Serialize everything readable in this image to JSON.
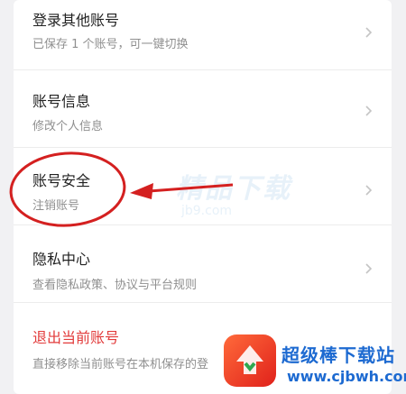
{
  "settings": {
    "items": [
      {
        "title": "登录其他账号",
        "subtitle": "已保存 1 个账号，可一键切换"
      },
      {
        "title": "账号信息",
        "subtitle": "修改个人信息"
      },
      {
        "title": "账号安全",
        "subtitle": "注销账号"
      },
      {
        "title": "隐私中心",
        "subtitle": "查看隐私政策、协议与平台规则"
      },
      {
        "title": "退出当前账号",
        "subtitle": "直接移除当前账号在本机保存的登"
      }
    ]
  },
  "watermark": {
    "text": "精品下载",
    "url": "jb9.com"
  },
  "site_badge": {
    "text": "超级棒下载站",
    "url": "www.cjbwh.com"
  },
  "colors": {
    "danger": "#e23b3b",
    "annotation": "#d42020",
    "badge_blue": "#1d6ad1"
  },
  "icons": {
    "chevron": "chevron-right-icon"
  }
}
